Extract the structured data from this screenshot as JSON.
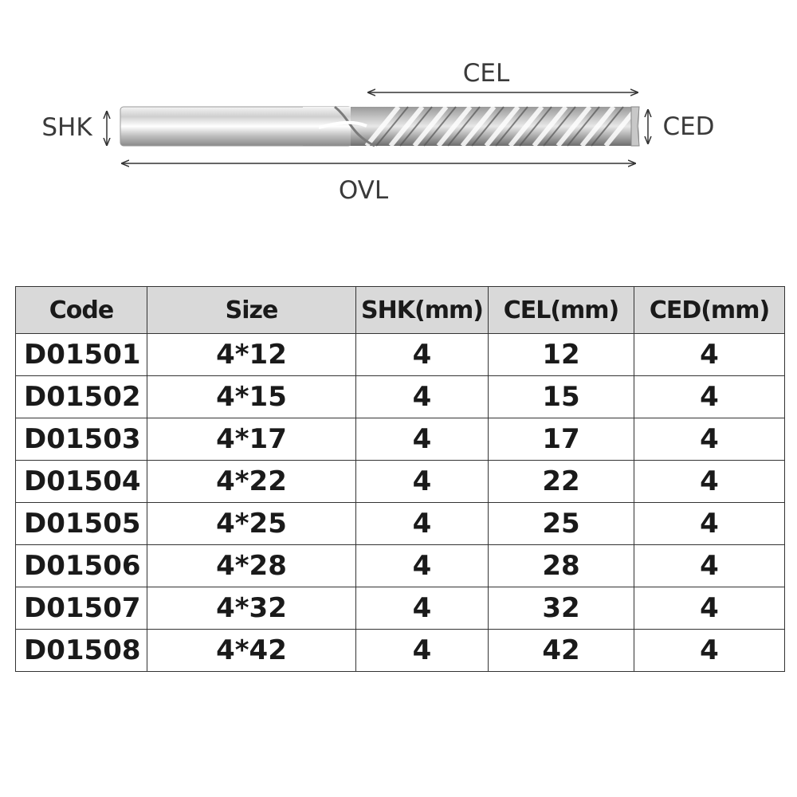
{
  "diagram": {
    "labels": {
      "cel": "CEL",
      "shk": "SHK",
      "ced": "CED",
      "ovl": "OVL"
    },
    "icon": "spiral-end-mill-bit"
  },
  "table": {
    "headers": {
      "code": "Code",
      "size": "Size",
      "shk": "SHK(mm)",
      "cel": "CEL(mm)",
      "ced": "CED(mm)"
    },
    "rows": [
      {
        "code": "D01501",
        "size": "4*12",
        "shk": "4",
        "cel": "12",
        "ced": "4"
      },
      {
        "code": "D01502",
        "size": "4*15",
        "shk": "4",
        "cel": "15",
        "ced": "4"
      },
      {
        "code": "D01503",
        "size": "4*17",
        "shk": "4",
        "cel": "17",
        "ced": "4"
      },
      {
        "code": "D01504",
        "size": "4*22",
        "shk": "4",
        "cel": "22",
        "ced": "4"
      },
      {
        "code": "D01505",
        "size": "4*25",
        "shk": "4",
        "cel": "25",
        "ced": "4"
      },
      {
        "code": "D01506",
        "size": "4*28",
        "shk": "4",
        "cel": "28",
        "ced": "4"
      },
      {
        "code": "D01507",
        "size": "4*32",
        "shk": "4",
        "cel": "32",
        "ced": "4"
      },
      {
        "code": "D01508",
        "size": "4*42",
        "shk": "4",
        "cel": "42",
        "ced": "4"
      }
    ],
    "header_background": "#d9d9d9",
    "border_color": "#333333"
  }
}
